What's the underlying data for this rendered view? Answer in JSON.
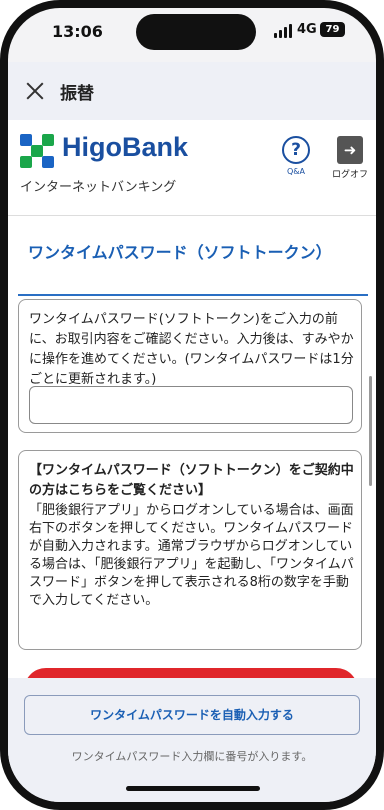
{
  "status_bar": {
    "time": "13:06",
    "network": "4G",
    "battery": "79"
  },
  "app_bar": {
    "close_icon": "close-icon",
    "title": "振替"
  },
  "bank_header": {
    "logo_text": "HigoBank",
    "subtitle": "インターネットバンキング",
    "qa_label": "Q&A",
    "logoff_label": "ログオフ",
    "colors": {
      "brand_blue": "#1a4fa0",
      "logo_green": "#1aa64a",
      "logo_blue": "#1a64c4"
    }
  },
  "content": {
    "section_title": "ワンタイムパスワード（ソフトトークン）",
    "card1_text": "ワンタイムパスワード(ソフトトークン)をご入力の前に、お取引内容をご確認ください。入力後は、すみやかに操作を進めてください。(ワンタイムパスワードは1分ごとに更新されます。)",
    "otp_input_value": "",
    "card2_heading": "【ワンタイムパスワード（ソフトトークン）をご契約中の方はこちらをご覧ください】",
    "card2_body": "「肥後銀行アプリ」からログオンしている場合は、画面右下のボタンを押してください。ワンタイムパスワードが自動入力されます。通常ブラウザからログオンしている場合は、「肥後銀行アプリ」を起動し、「ワンタイムパスワード」ボタンを押して表示される8桁の数字を手動で入力してください。",
    "accent_red": "#e0262b"
  },
  "bottom_sheet": {
    "autofill_button": "ワンタイムパスワードを自動入力する",
    "hint": "ワンタイムパスワード入力欄に番号が入ります。"
  }
}
